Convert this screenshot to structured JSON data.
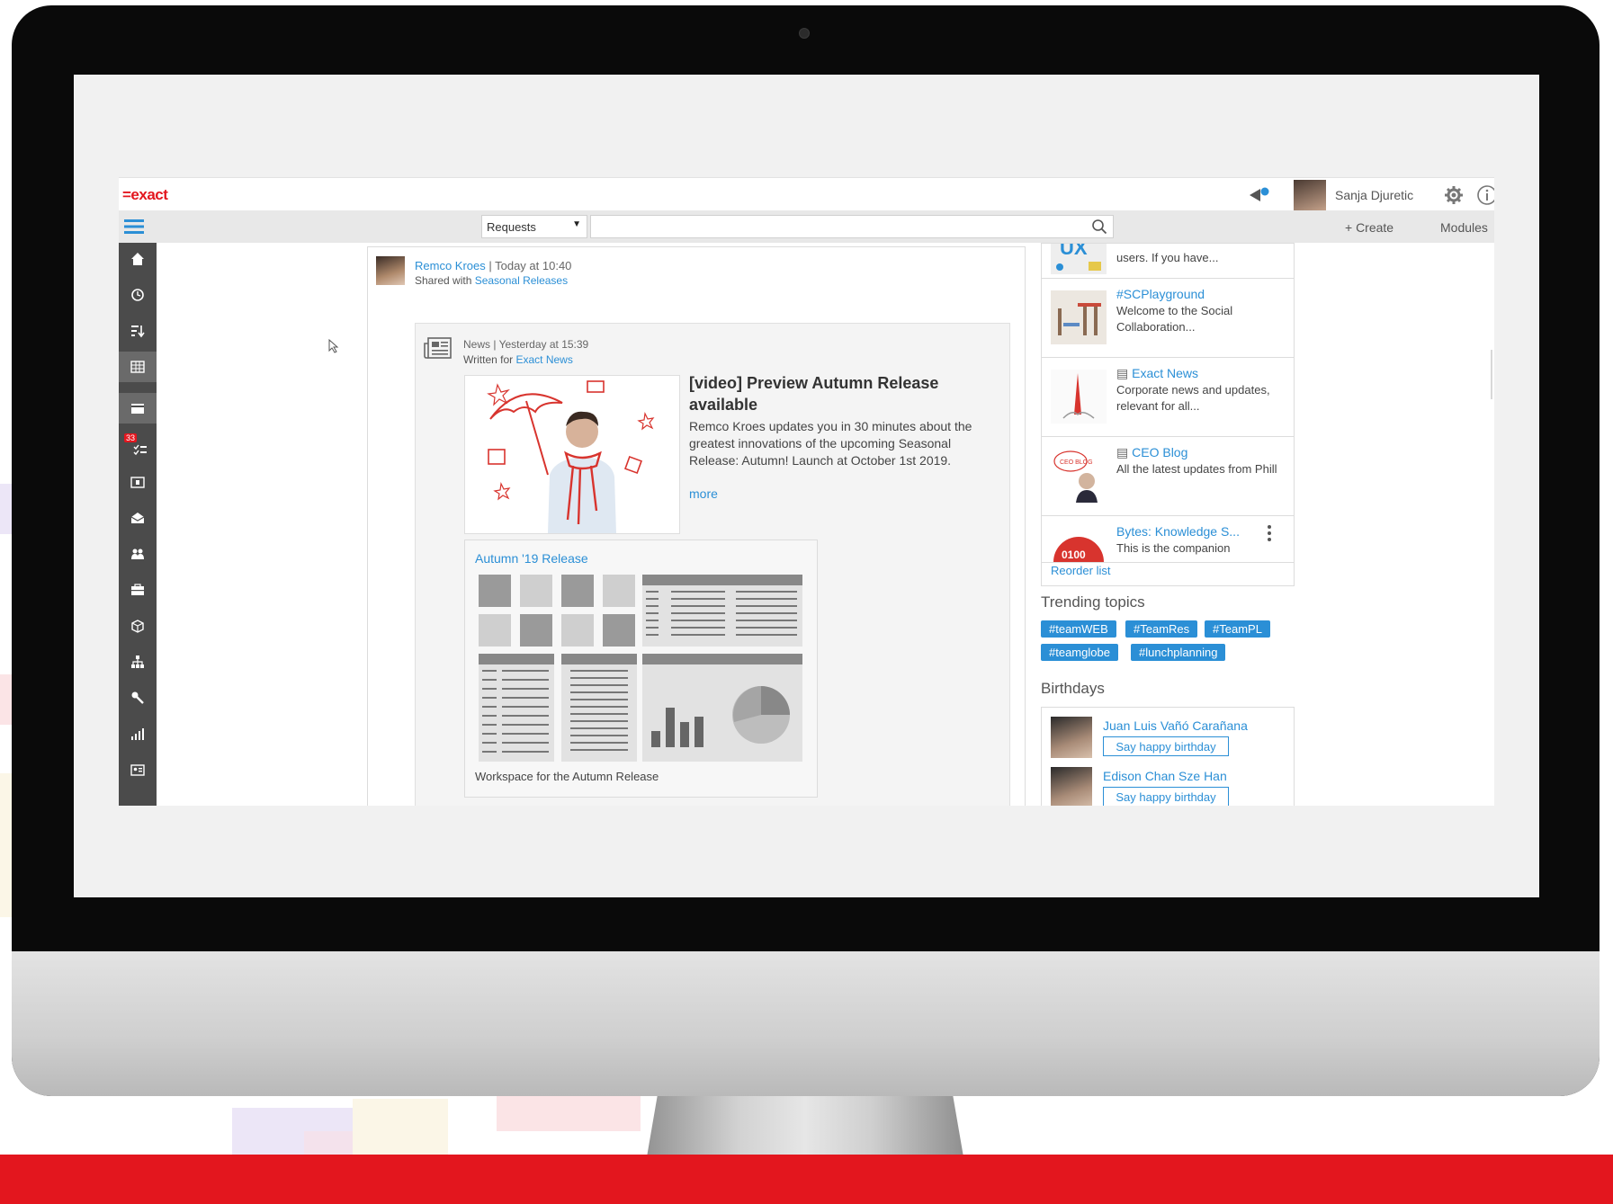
{
  "app": {
    "logo": "=exact",
    "user_name": "Sanja Djuretic"
  },
  "toolbar": {
    "search_scope": "Requests",
    "search_placeholder": "",
    "create_label": "+ Create",
    "modules_label": "Modules"
  },
  "sidebar": {
    "badge_count": "33",
    "items": [
      "home-icon",
      "clock-icon",
      "sort-icon",
      "table-icon",
      "card-icon",
      "tasks-icon",
      "folder-icon",
      "mail-icon",
      "people-icon",
      "briefcase-icon",
      "box-icon",
      "org-chart-icon",
      "tools-icon",
      "chart-icon",
      "contact-card-icon"
    ]
  },
  "post": {
    "author": "Remco Kroes",
    "time": " | Today at 10:40",
    "shared_prefix": "Shared with ",
    "shared_group": "Seasonal Releases"
  },
  "news": {
    "type": "News",
    "time": " | Yesterday at 15:39",
    "written_prefix": "Written for ",
    "written_for": "Exact News",
    "title": "[video] Preview Autumn Release available",
    "body": "Remco Kroes updates you in 30 minutes about the greatest innovations of the upcoming Seasonal Release: Autumn! Launch at October 1st 2019.",
    "more": "more"
  },
  "workspace": {
    "title": "Autumn '19 Release",
    "caption": "Workspace for the Autumn Release"
  },
  "right_list": {
    "items": [
      {
        "title": "",
        "desc": "users. If you have..."
      },
      {
        "title": "#SCPlayground",
        "desc": "Welcome to the Social Collaboration..."
      },
      {
        "title": "Exact News",
        "desc": "Corporate news and updates, relevant for all..."
      },
      {
        "title": "CEO Blog",
        "desc": "All the latest updates from Phill"
      },
      {
        "title": "Bytes: Knowledge S...",
        "desc": "This is the companion"
      }
    ],
    "reorder": "Reorder list",
    "ceo_thumb_text": "CEO BLOG",
    "bytes_thumb_text": "0100"
  },
  "trending": {
    "title": "Trending topics",
    "tags": [
      "#teamWEB",
      "#TeamRes",
      "#TeamPL",
      "#teamglobe",
      "#lunchplanning"
    ]
  },
  "birthdays": {
    "title": "Birthdays",
    "people": [
      {
        "name": "Juan Luis Vañó Carañana",
        "action": "Say happy birthday"
      },
      {
        "name": "Edison Chan Sze Han",
        "action": "Say happy birthday"
      }
    ]
  },
  "colors": {
    "brand_red": "#e3161e",
    "link_blue": "#2b8fd6",
    "sidebar": "#4b4b4b"
  }
}
